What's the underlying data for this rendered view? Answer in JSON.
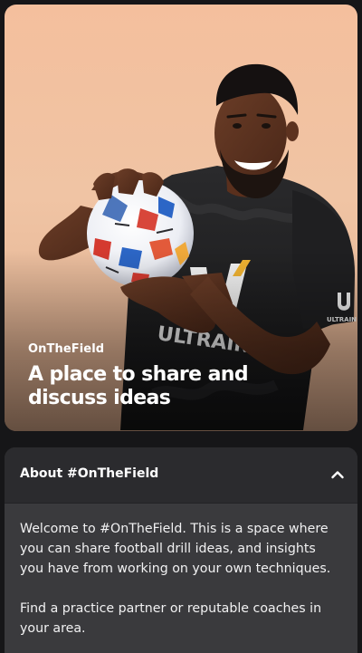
{
  "hero": {
    "eyebrow": "OnTheField",
    "title": "A place to share and discuss ideas",
    "image": "footballer-holding-ball-photo",
    "shirt_lettering": "ULTRAIN"
  },
  "about": {
    "title": "About #OnTheField",
    "toggle_icon": "chevron-up-icon",
    "paragraphs": [
      "Welcome to #OnTheField. This is a space where you can share football drill ideas, and insights you have from working on your own techniques.",
      "Find a practice partner or reputable coaches in your area."
    ]
  },
  "colors": {
    "page_background": "#161618",
    "hero_background": "#f2c1a1",
    "about_header": "#2b2b2e",
    "about_body": "#3a3a3d",
    "text": "#ffffff"
  }
}
